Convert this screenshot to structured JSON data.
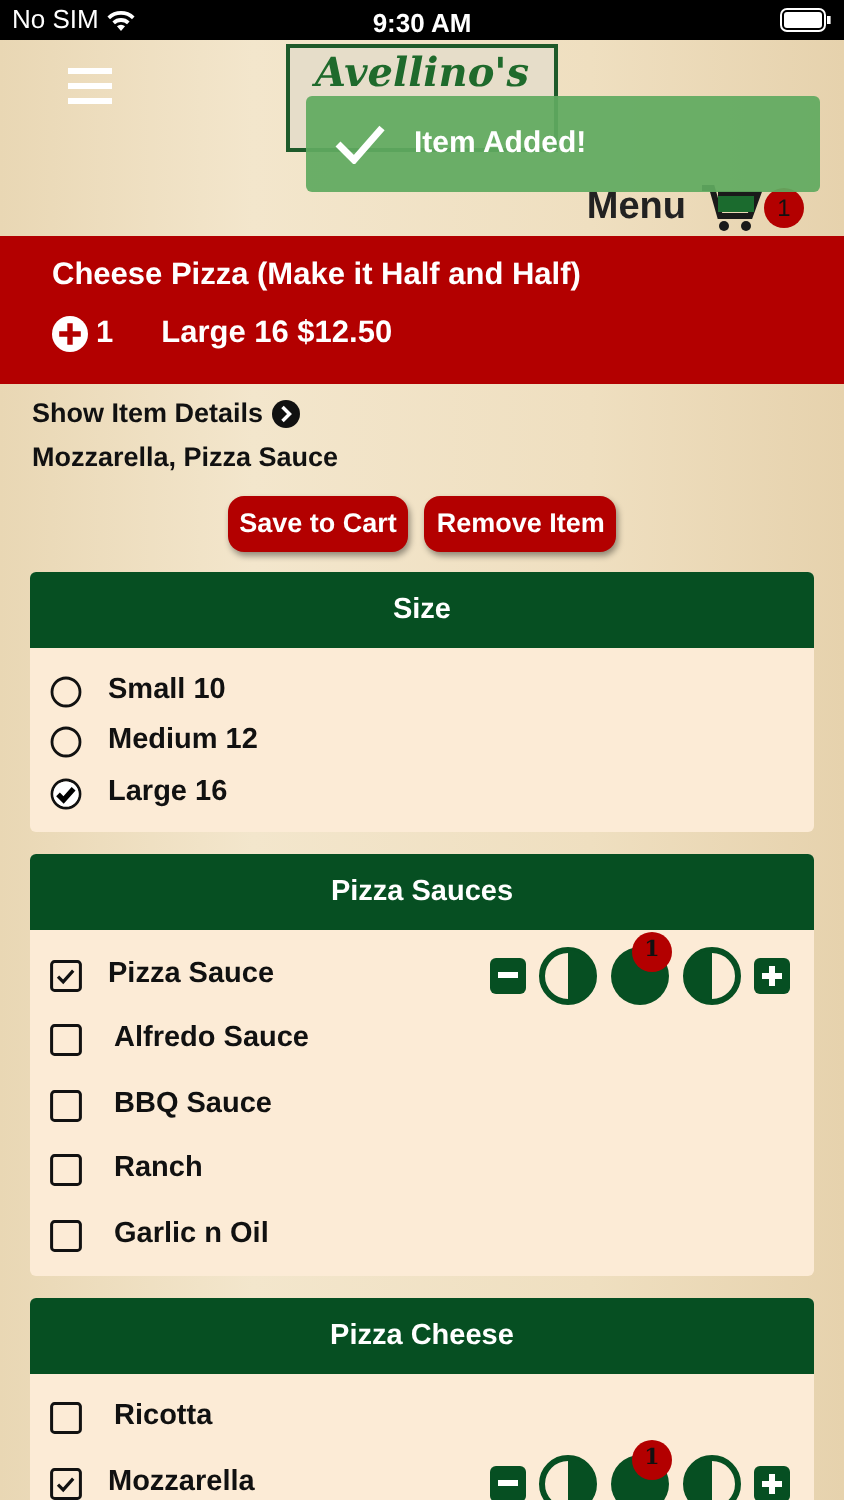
{
  "status_bar": {
    "carrier": "No SIM",
    "time": "9:30 AM"
  },
  "header": {
    "logo": "Avellino's",
    "menu_label": "Menu",
    "cart_count": "1"
  },
  "toast": {
    "text": "Item Added!"
  },
  "item": {
    "title": "Cheese Pizza (Make it Half and Half)",
    "quantity": "1",
    "size_price": "Large 16 $12.50"
  },
  "details": {
    "link": "Show Item Details",
    "description": "Mozzarella, Pizza Sauce"
  },
  "buttons": [
    "Save to Cart",
    "Remove Item"
  ],
  "sections": [
    {
      "title": "Size",
      "kind": "radio",
      "options": [
        {
          "label": "Small 10",
          "selected": false
        },
        {
          "label": "Medium 12",
          "selected": false
        },
        {
          "label": "Large 16",
          "selected": true
        }
      ]
    },
    {
      "title": "Pizza Sauces",
      "kind": "checkbox",
      "options": [
        {
          "label": "Pizza Sauce",
          "checked": true,
          "portions": [
            {
              "kind": "left"
            },
            {
              "kind": "whole",
              "amount": "1"
            },
            {
              "kind": "right"
            }
          ]
        },
        {
          "label": "Alfredo Sauce",
          "checked": false
        },
        {
          "label": "BBQ Sauce",
          "checked": false
        },
        {
          "label": "Ranch",
          "checked": false
        },
        {
          "label": "Garlic n Oil",
          "checked": false
        }
      ]
    },
    {
      "title": "Pizza Cheese",
      "kind": "checkbox",
      "options": [
        {
          "label": "Ricotta",
          "checked": false
        },
        {
          "label": "Mozzarella",
          "checked": true,
          "portions": [
            {
              "kind": "left"
            },
            {
              "kind": "whole",
              "amount": "1"
            },
            {
              "kind": "right"
            }
          ]
        }
      ]
    }
  ]
}
